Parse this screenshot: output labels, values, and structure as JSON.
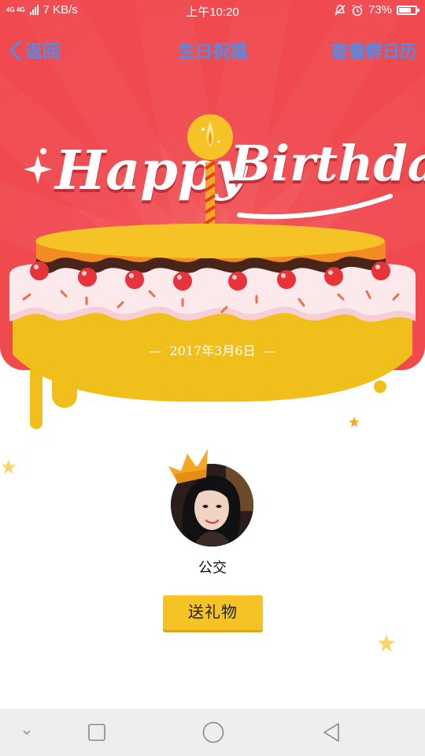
{
  "status_bar": {
    "network": "4G 4G",
    "speed": "7 KB/s",
    "time": "上午10:20",
    "battery": "73%",
    "battery_level": 0.73
  },
  "nav": {
    "back_label": "返回",
    "title": "生日祝福",
    "calendar_label": "查看群日历"
  },
  "banner": {
    "happy": "Happy",
    "birthday": "Birthday",
    "date": "2017年3月6日"
  },
  "profile": {
    "name": "公交",
    "gift_button": "送礼物"
  },
  "colors": {
    "banner_red": "#f04a4f",
    "nav_text_blue": "#4a8ff0",
    "cake_yellow": "#f0bf1c",
    "button_yellow": "#f5c326"
  },
  "icons": {
    "back": "chevron-left-icon",
    "crown": "crown-icon",
    "candle": "candle-icon",
    "system_back": "triangle-back-icon",
    "system_home": "circle-home-icon",
    "system_recent": "square-recent-icon",
    "system_collapse": "chevron-down-icon"
  }
}
